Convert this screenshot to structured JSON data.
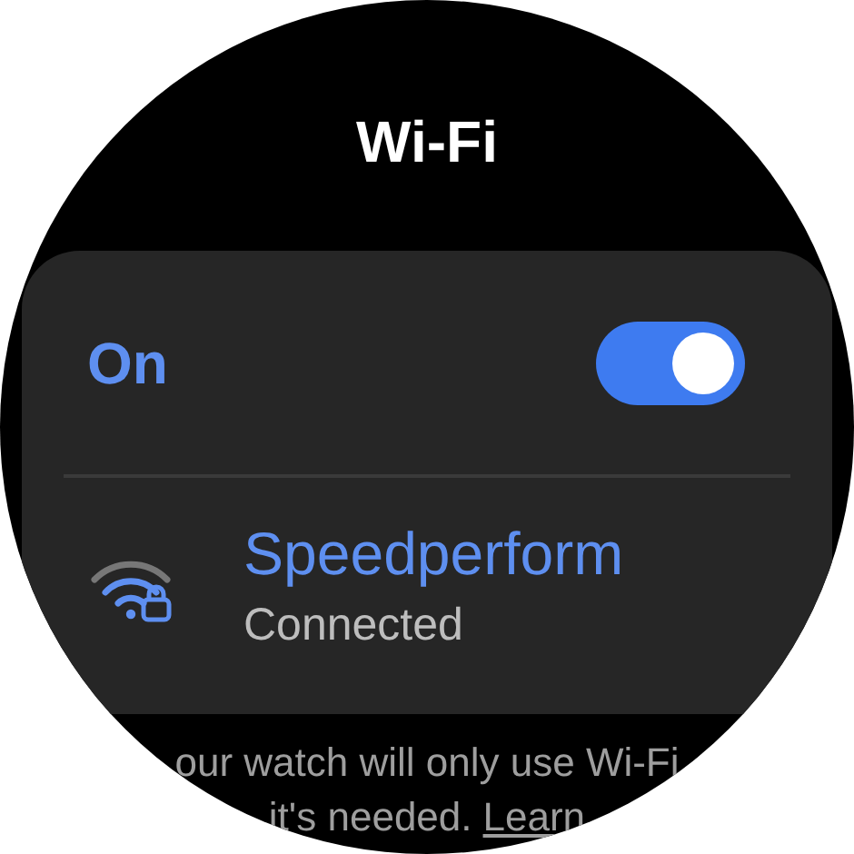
{
  "title": "Wi-Fi",
  "toggle": {
    "label": "On",
    "on": true
  },
  "network": {
    "name": "Speedperform",
    "status": "Connected"
  },
  "footer": {
    "line_1": "our watch will only use Wi-Fi",
    "line_2": "it's needed.",
    "link": "Learn"
  }
}
